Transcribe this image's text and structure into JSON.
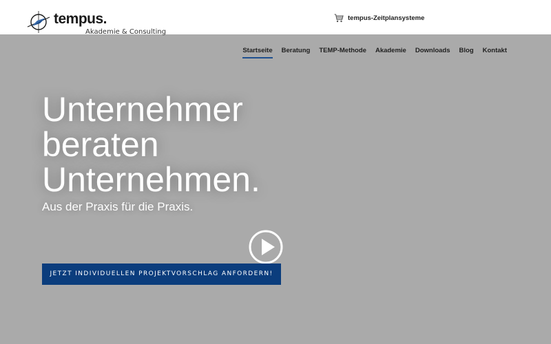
{
  "header": {
    "logo_word": "tempus.",
    "logo_sub": "Akademie & Consulting",
    "shop_link": {
      "icon": "cart-icon",
      "label": "tempus-Zeitplansysteme"
    }
  },
  "nav": {
    "items": [
      {
        "label": "Startseite",
        "active": true
      },
      {
        "label": "Beratung"
      },
      {
        "label": "TEMP-Methode"
      },
      {
        "label": "Akademie"
      },
      {
        "label": "Downloads"
      },
      {
        "label": "Blog"
      },
      {
        "label": "Kontakt"
      }
    ],
    "active_color": "#1e4f8f"
  },
  "hero": {
    "title": "Unternehmer beraten Unternehmen.",
    "subtitle": "Aus der Praxis für die Praxis.",
    "play_icon": "play-icon",
    "cta_label": "JETZT INDIVIDUELLEN PROJEKTVORSCHLAG ANFORDERN!"
  },
  "colors": {
    "background": "#aaaaaa",
    "cta_background": "#0b3d7d",
    "topbar": "#ffffff"
  }
}
